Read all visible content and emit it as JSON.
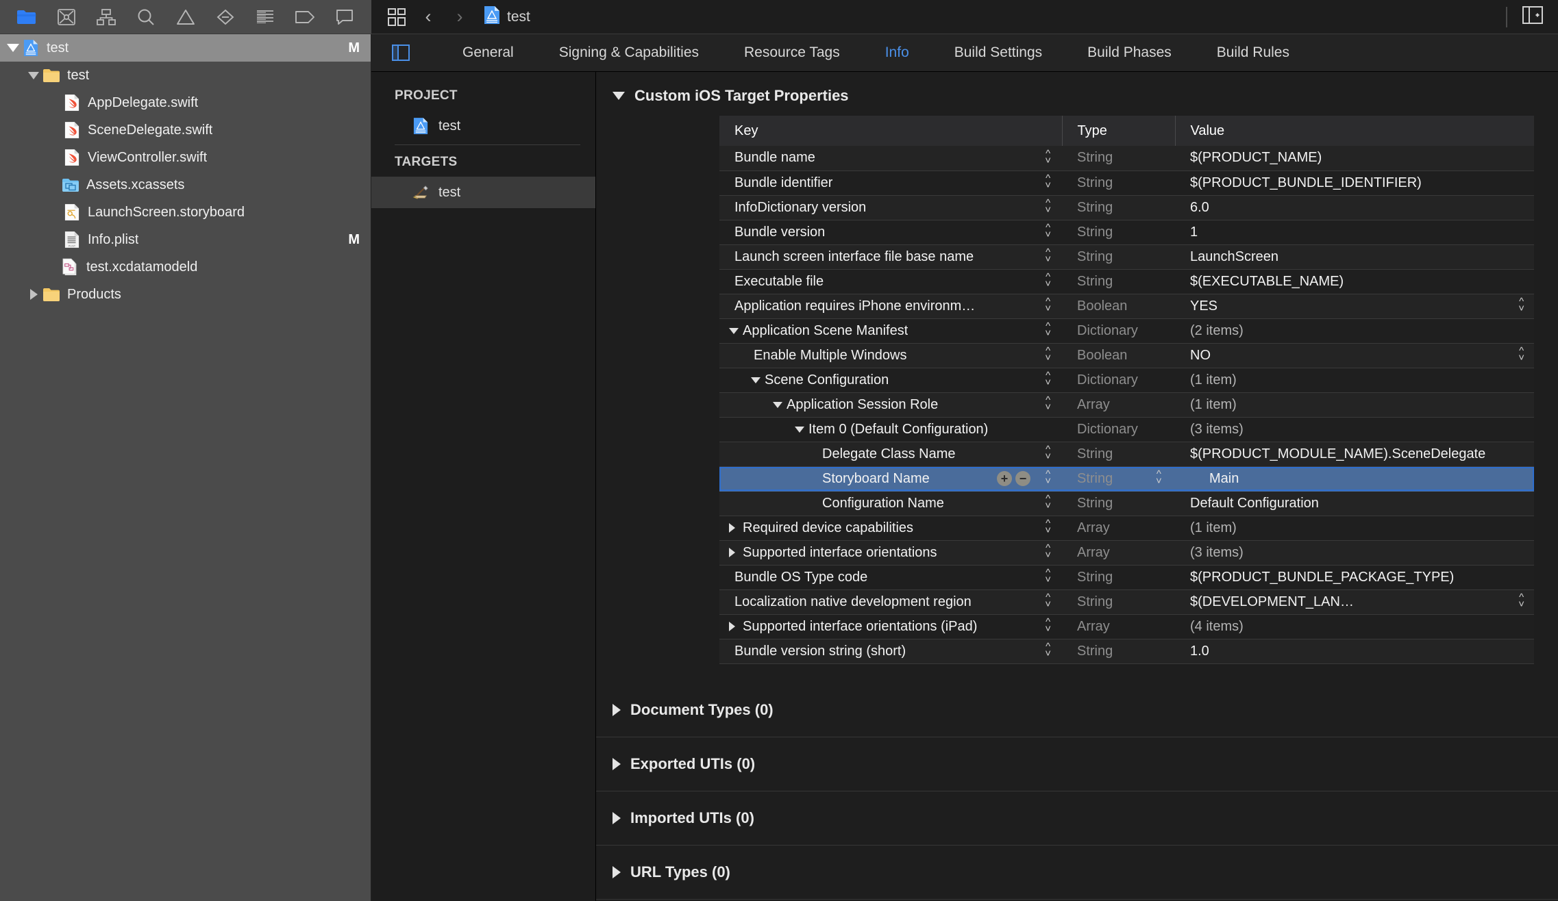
{
  "navigator_toolbar": {
    "icons": [
      {
        "name": "project-navigator-icon",
        "label": "Project navigator",
        "active": true
      },
      {
        "name": "source-control-navigator-icon",
        "label": "Source control navigator",
        "active": false
      },
      {
        "name": "symbol-navigator-icon",
        "label": "Symbol navigator",
        "active": false
      },
      {
        "name": "find-navigator-icon",
        "label": "Find navigator",
        "active": false
      },
      {
        "name": "issue-navigator-icon",
        "label": "Issue navigator",
        "active": false
      },
      {
        "name": "test-navigator-icon",
        "label": "Test navigator",
        "active": false
      },
      {
        "name": "debug-navigator-icon",
        "label": "Debug navigator",
        "active": false
      },
      {
        "name": "breakpoint-navigator-icon",
        "label": "Breakpoint navigator",
        "active": false
      },
      {
        "name": "report-navigator-icon",
        "label": "Report navigator",
        "active": false
      }
    ]
  },
  "navigator": {
    "rows": [
      {
        "label": "test",
        "icon": "xcode-project-icon",
        "depth": 0,
        "disclosure": "down",
        "badge": "M",
        "selected": true
      },
      {
        "label": "test",
        "icon": "folder-icon",
        "depth": 1,
        "disclosure": "down",
        "badge": "",
        "selected": false
      },
      {
        "label": "AppDelegate.swift",
        "icon": "swift-file-icon",
        "depth": 2,
        "disclosure": "",
        "badge": "",
        "selected": false
      },
      {
        "label": "SceneDelegate.swift",
        "icon": "swift-file-icon",
        "depth": 2,
        "disclosure": "",
        "badge": "",
        "selected": false
      },
      {
        "label": "ViewController.swift",
        "icon": "swift-file-icon",
        "depth": 2,
        "disclosure": "",
        "badge": "",
        "selected": false
      },
      {
        "label": "Assets.xcassets",
        "icon": "assets-catalog-icon",
        "depth": 2,
        "disclosure": "",
        "badge": "",
        "selected": false
      },
      {
        "label": "LaunchScreen.storyboard",
        "icon": "storyboard-file-icon",
        "depth": 2,
        "disclosure": "",
        "badge": "",
        "selected": false
      },
      {
        "label": "Info.plist",
        "icon": "plist-file-icon",
        "depth": 2,
        "disclosure": "",
        "badge": "M",
        "selected": false
      },
      {
        "label": "test.xcdatamodeld",
        "icon": "xcdatamodel-icon",
        "depth": 2,
        "disclosure": "",
        "badge": "",
        "selected": false
      },
      {
        "label": "Products",
        "icon": "folder-icon",
        "depth": 1,
        "disclosure": "right",
        "badge": "",
        "selected": false
      }
    ]
  },
  "editor_topbar": {
    "back_glyph": "‹",
    "forward_glyph": "›",
    "breadcrumb_label": "test",
    "tab_overview_icon": "tab-overview-icon",
    "inspector_toggle_icon": "inspector-toggle-icon"
  },
  "tabbar": {
    "panel_toggle_icon": "navigator-toggle-icon",
    "tabs": [
      {
        "label": "General",
        "active": false
      },
      {
        "label": "Signing & Capabilities",
        "active": false
      },
      {
        "label": "Resource Tags",
        "active": false
      },
      {
        "label": "Info",
        "active": true
      },
      {
        "label": "Build Settings",
        "active": false
      },
      {
        "label": "Build Phases",
        "active": false
      },
      {
        "label": "Build Rules",
        "active": false
      }
    ]
  },
  "targets_sidebar": {
    "project_header": "PROJECT",
    "project_items": [
      {
        "label": "test",
        "icon": "xcode-project-icon",
        "selected": false
      }
    ],
    "targets_header": "TARGETS",
    "target_items": [
      {
        "label": "test",
        "icon": "app-target-icon",
        "selected": true
      }
    ]
  },
  "plist": {
    "section_title": "Custom iOS Target Properties",
    "columns": [
      "Key",
      "Type",
      "Value"
    ],
    "rows": [
      {
        "key": "Bundle name",
        "type": "String",
        "value": "$(PRODUCT_NAME)",
        "indent": 0,
        "disclosure": "",
        "stepper": true,
        "value_stepper": false,
        "muted": false,
        "selected": false
      },
      {
        "key": "Bundle identifier",
        "type": "String",
        "value": "$(PRODUCT_BUNDLE_IDENTIFIER)",
        "indent": 0,
        "disclosure": "",
        "stepper": true,
        "value_stepper": false,
        "muted": false,
        "selected": false
      },
      {
        "key": "InfoDictionary version",
        "type": "String",
        "value": "6.0",
        "indent": 0,
        "disclosure": "",
        "stepper": true,
        "value_stepper": false,
        "muted": false,
        "selected": false
      },
      {
        "key": "Bundle version",
        "type": "String",
        "value": "1",
        "indent": 0,
        "disclosure": "",
        "stepper": true,
        "value_stepper": false,
        "muted": false,
        "selected": false
      },
      {
        "key": "Launch screen interface file base name",
        "type": "String",
        "value": "LaunchScreen",
        "indent": 0,
        "disclosure": "",
        "stepper": true,
        "value_stepper": false,
        "muted": false,
        "selected": false
      },
      {
        "key": "Executable file",
        "type": "String",
        "value": "$(EXECUTABLE_NAME)",
        "indent": 0,
        "disclosure": "",
        "stepper": true,
        "value_stepper": false,
        "muted": false,
        "selected": false
      },
      {
        "key": "Application requires iPhone environm…",
        "type": "Boolean",
        "value": "YES",
        "indent": 0,
        "disclosure": "",
        "stepper": true,
        "value_stepper": true,
        "muted": false,
        "selected": false
      },
      {
        "key": "Application Scene Manifest",
        "type": "Dictionary",
        "value": "(2 items)",
        "indent": 0,
        "disclosure": "down",
        "stepper": true,
        "value_stepper": false,
        "muted": true,
        "selected": false
      },
      {
        "key": "Enable Multiple Windows",
        "type": "Boolean",
        "value": "NO",
        "indent": 1,
        "disclosure": "",
        "stepper": true,
        "value_stepper": true,
        "muted": false,
        "selected": false
      },
      {
        "key": "Scene Configuration",
        "type": "Dictionary",
        "value": "(1 item)",
        "indent": 1,
        "disclosure": "down",
        "stepper": true,
        "value_stepper": false,
        "muted": true,
        "selected": false
      },
      {
        "key": "Application Session Role",
        "type": "Array",
        "value": "(1 item)",
        "indent": 2,
        "disclosure": "down",
        "stepper": true,
        "value_stepper": false,
        "muted": true,
        "selected": false
      },
      {
        "key": "Item 0 (Default Configuration)",
        "type": "Dictionary",
        "value": "(3 items)",
        "indent": 3,
        "disclosure": "down",
        "stepper": false,
        "value_stepper": false,
        "muted": true,
        "selected": false
      },
      {
        "key": "Delegate Class Name",
        "type": "String",
        "value": "$(PRODUCT_MODULE_NAME).SceneDelegate",
        "indent": 4,
        "disclosure": "",
        "stepper": true,
        "value_stepper": false,
        "muted": false,
        "selected": false
      },
      {
        "key": "Storyboard Name",
        "type": "String",
        "value": "Main",
        "indent": 4,
        "disclosure": "",
        "stepper": true,
        "value_stepper": false,
        "muted": false,
        "selected": true,
        "add_label": "+",
        "remove_label": "−"
      },
      {
        "key": "Configuration Name",
        "type": "String",
        "value": "Default Configuration",
        "indent": 4,
        "disclosure": "",
        "stepper": true,
        "value_stepper": false,
        "muted": false,
        "selected": false
      },
      {
        "key": "Required device capabilities",
        "type": "Array",
        "value": "(1 item)",
        "indent": 0,
        "disclosure": "right",
        "stepper": true,
        "value_stepper": false,
        "muted": true,
        "selected": false
      },
      {
        "key": "Supported interface orientations",
        "type": "Array",
        "value": "(3 items)",
        "indent": 0,
        "disclosure": "right",
        "stepper": true,
        "value_stepper": false,
        "muted": true,
        "selected": false
      },
      {
        "key": "Bundle OS Type code",
        "type": "String",
        "value": "$(PRODUCT_BUNDLE_PACKAGE_TYPE)",
        "indent": 0,
        "disclosure": "",
        "stepper": true,
        "value_stepper": false,
        "muted": false,
        "selected": false
      },
      {
        "key": "Localization native development region",
        "type": "String",
        "value": "$(DEVELOPMENT_LAN…",
        "indent": 0,
        "disclosure": "",
        "stepper": true,
        "value_stepper": true,
        "muted": false,
        "selected": false
      },
      {
        "key": "Supported interface orientations (iPad)",
        "type": "Array",
        "value": "(4 items)",
        "indent": 0,
        "disclosure": "right",
        "stepper": true,
        "value_stepper": false,
        "muted": true,
        "selected": false
      },
      {
        "key": "Bundle version string (short)",
        "type": "String",
        "value": "1.0",
        "indent": 0,
        "disclosure": "",
        "stepper": true,
        "value_stepper": false,
        "muted": false,
        "selected": false
      }
    ],
    "collapsed_sections": [
      {
        "label": "Document Types (0)"
      },
      {
        "label": "Exported UTIs (0)"
      },
      {
        "label": "Imported UTIs (0)"
      },
      {
        "label": "URL Types (0)"
      }
    ]
  },
  "colors": {
    "accent_blue": "#4a8fe7",
    "selection_blue": "#4a6c9b",
    "selection_border": "#2f6fce",
    "navigator_bg": "#4b4b4b",
    "editor_bg": "#1e1e1e"
  }
}
